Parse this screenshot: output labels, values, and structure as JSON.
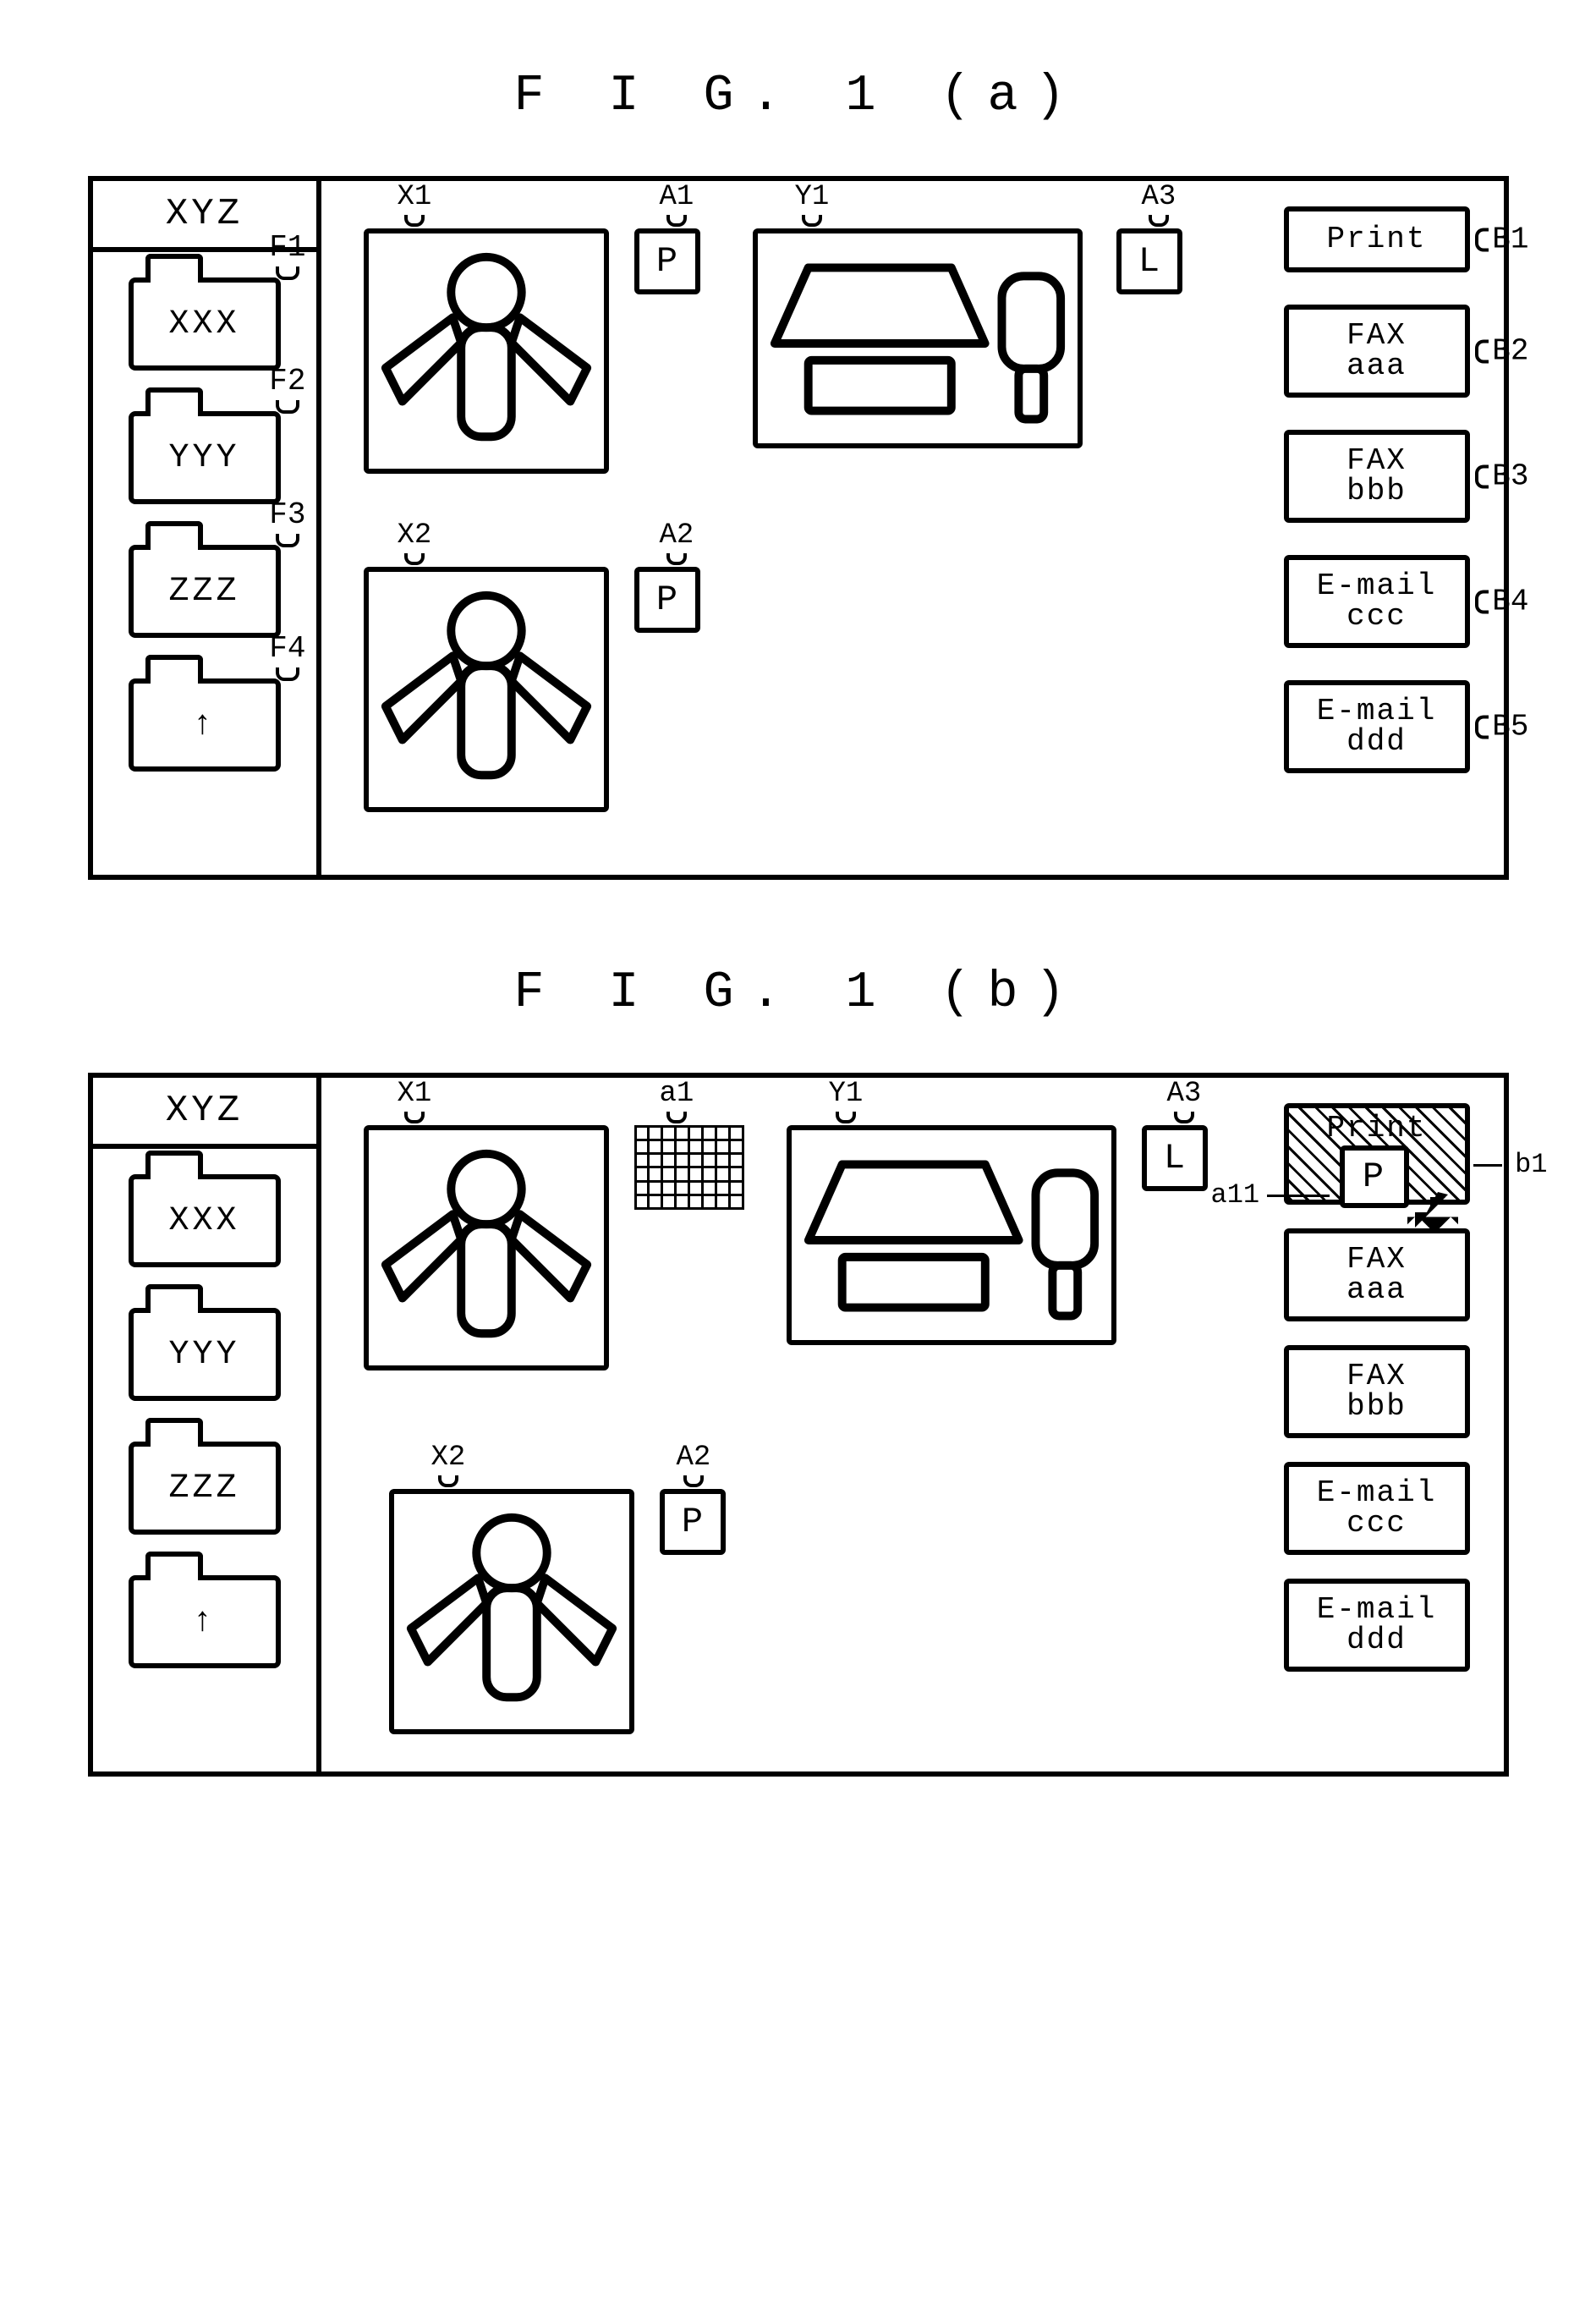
{
  "figures": {
    "a": {
      "title": "F I G.  1 (a)",
      "sidebar_header": "XYZ",
      "sidebar": [
        {
          "text": "XXX",
          "tag": "F1"
        },
        {
          "text": "YYY",
          "tag": "F2"
        },
        {
          "text": "ZZZ",
          "tag": "F3"
        },
        {
          "text": "↑",
          "tag": "F4"
        }
      ],
      "thumbs": {
        "X1": "X1",
        "X2": "X2",
        "Y1": "Y1"
      },
      "orients": {
        "A1": {
          "tag": "A1",
          "val": "P"
        },
        "A2": {
          "tag": "A2",
          "val": "P"
        },
        "A3": {
          "tag": "A3",
          "val": "L"
        }
      },
      "dests": [
        {
          "tag": "B1",
          "l1": "Print",
          "l2": ""
        },
        {
          "tag": "B2",
          "l1": "FAX",
          "l2": "aaa"
        },
        {
          "tag": "B3",
          "l1": "FAX",
          "l2": "bbb"
        },
        {
          "tag": "B4",
          "l1": "E-mail",
          "l2": "ccc"
        },
        {
          "tag": "B5",
          "l1": "E-mail",
          "l2": "ddd"
        }
      ]
    },
    "b": {
      "title": "F I G.  1 (b)",
      "sidebar_header": "XYZ",
      "sidebar": [
        {
          "text": "XXX"
        },
        {
          "text": "YYY"
        },
        {
          "text": "ZZZ"
        },
        {
          "text": "↑"
        }
      ],
      "thumbs": {
        "X1": "X1",
        "X2": "X2",
        "Y1": "Y1"
      },
      "orients": {
        "a1": {
          "tag": "a1"
        },
        "A2": {
          "tag": "A2",
          "val": "P"
        },
        "A3": {
          "tag": "A3",
          "val": "L"
        }
      },
      "dests_plain": [
        {
          "l1": "FAX",
          "l2": "aaa"
        },
        {
          "l1": "FAX",
          "l2": "bbb"
        },
        {
          "l1": "E-mail",
          "l2": "ccc"
        },
        {
          "l1": "E-mail",
          "l2": "ddd"
        }
      ],
      "print_label": "Print",
      "drag_p_label": "P",
      "callouts": {
        "b1": "b1",
        "a11": "a11"
      }
    }
  }
}
